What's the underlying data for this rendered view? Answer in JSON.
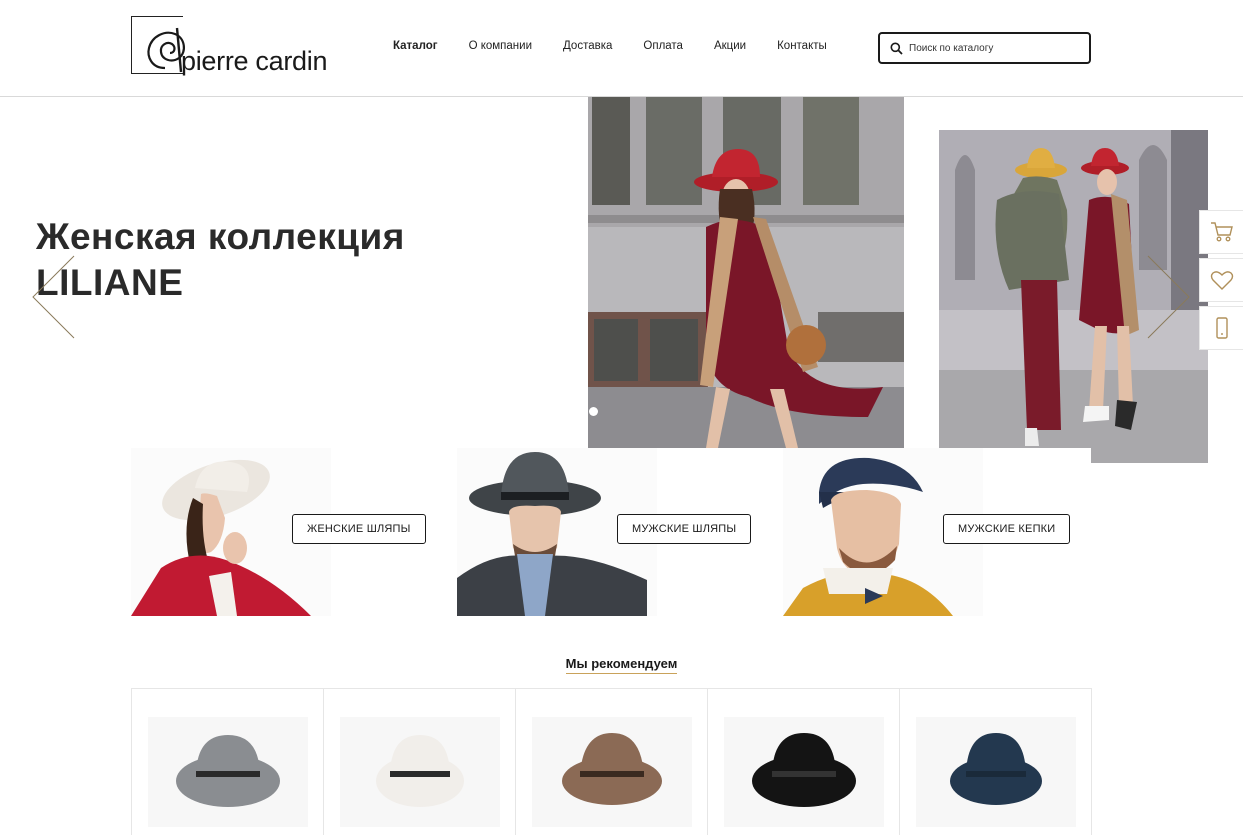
{
  "header": {
    "logo_text": "pierre cardin",
    "nav": [
      "Каталог",
      "О компании",
      "Доставка",
      "Оплата",
      "Акции",
      "Контакты"
    ],
    "search_placeholder": "Поиск по каталогу"
  },
  "hero": {
    "title_line1": "Женская коллекция",
    "title_line2": "LILIANE"
  },
  "categories": [
    {
      "label": "ЖЕНСКИЕ ШЛЯПЫ"
    },
    {
      "label": "МУЖСКИЕ ШЛЯПЫ"
    },
    {
      "label": "МУЖСКИЕ КЕПКИ"
    }
  ],
  "recommended": {
    "title": "Мы рекомендуем",
    "products": [
      {
        "color": "#8a8d91",
        "band": "#2a2a2a"
      },
      {
        "color": "#f1eeea",
        "band": "#2a2a2a"
      },
      {
        "color": "#8b6a55",
        "band": "#3a2a20"
      },
      {
        "color": "#141414",
        "band": "#333333"
      },
      {
        "color": "#23384f",
        "band": "#1a2a3a"
      }
    ]
  },
  "colors": {
    "accent": "#c9a25a",
    "hat_red": "#b01e28",
    "dress_wine": "#7a1628"
  },
  "icons": [
    "search-icon",
    "cart-icon",
    "heart-icon",
    "phone-icon",
    "chevron-left-icon",
    "chevron-right-icon"
  ]
}
